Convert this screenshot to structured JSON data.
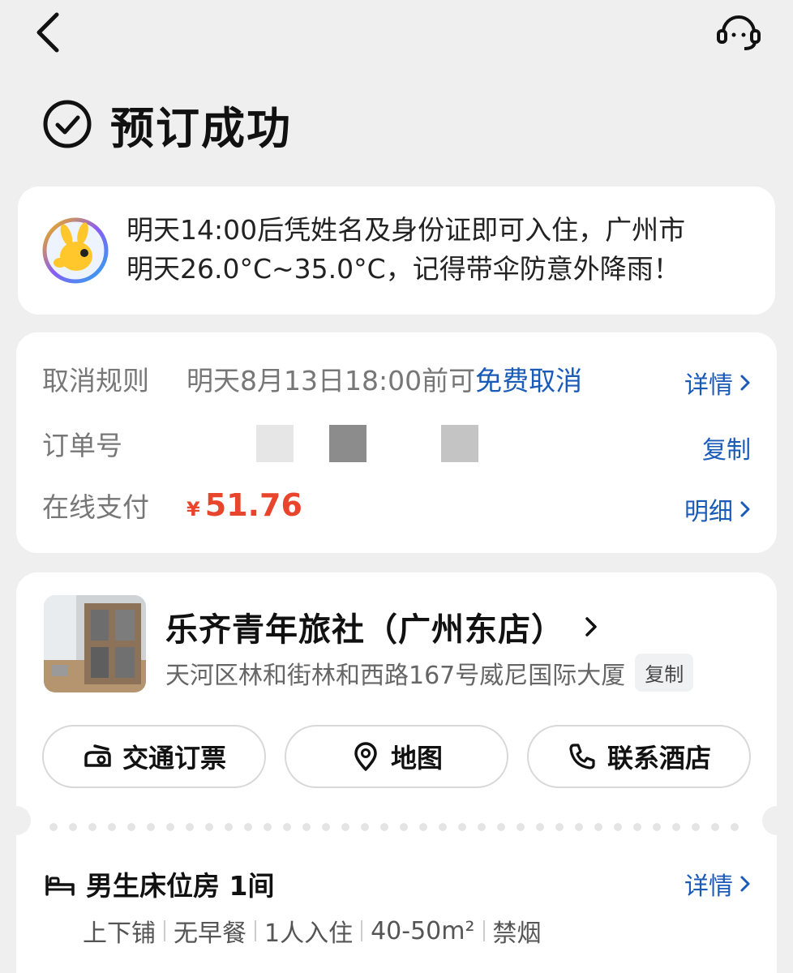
{
  "status": {
    "title": "预订成功"
  },
  "tip": {
    "line1": "明天14:00后凭姓名及身份证即可入住，广州市",
    "line2": "明天26.0°C~35.0°C，记得带伞防意外降雨！"
  },
  "order": {
    "cancel_label": "取消规则",
    "cancel_prefix": "明天8月13日18:00前可",
    "cancel_free": "免费取消",
    "cancel_action": "详情",
    "number_label": "订单号",
    "number_action": "复制",
    "payment_label": "在线支付",
    "payment_currency": "¥",
    "payment_amount": "51.76",
    "payment_action": "明细"
  },
  "hotel": {
    "name": "乐齐青年旅社（广州东店）",
    "address": "天河区林和街林和西路167号威尼国际大厦",
    "copy_label": "复制",
    "buttons": [
      {
        "label": "交通订票",
        "icon": "transport-icon"
      },
      {
        "label": "地图",
        "icon": "map-pin-icon"
      },
      {
        "label": "联系酒店",
        "icon": "phone-icon"
      }
    ]
  },
  "room": {
    "name": "男生床位房 1间",
    "detail_label": "详情",
    "tags": [
      "上下铺",
      "无早餐",
      "1人入住",
      "40-50m²",
      "禁烟"
    ]
  },
  "colors": {
    "link": "#1a5bb8",
    "price": "#e8452c",
    "background": "#efefef"
  }
}
